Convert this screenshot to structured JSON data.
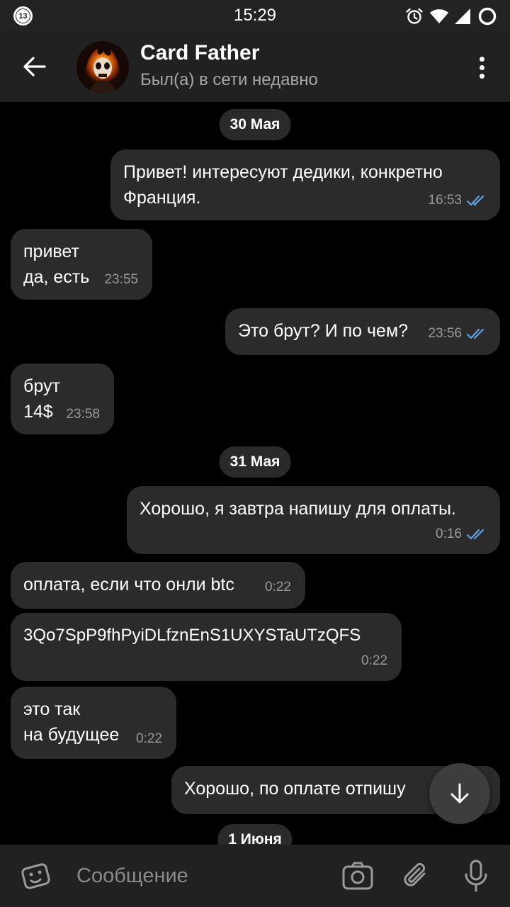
{
  "status_bar": {
    "notification_count": "13",
    "time": "15:29",
    "icons": [
      "alarm-icon",
      "wifi-icon",
      "signal-icon",
      "battery-icon"
    ]
  },
  "header": {
    "name": "Card Father",
    "status": "Был(а) в сети недавно",
    "icons": [
      "back-arrow-icon",
      "avatar",
      "more-vertical-icon"
    ]
  },
  "chat": {
    "dates": [
      "30 Мая",
      "31 Мая",
      "1 Июня"
    ],
    "messages": [
      {
        "direction": "out",
        "text": "Привет! интересуют дедики, конкретно\nФранция.",
        "time": "16:53",
        "read": true
      },
      {
        "direction": "in",
        "text": "привет\nда, есть",
        "time": "23:55"
      },
      {
        "direction": "out",
        "text": "Это брут? И по чем?",
        "time": "23:56",
        "read": true
      },
      {
        "direction": "in",
        "text": "брут\n14$",
        "time": "23:58"
      },
      {
        "direction": "out",
        "text": "Хорошо, я завтра напишу для оплаты.",
        "time": "0:16",
        "read": true
      },
      {
        "direction": "in",
        "text": "оплата, если что онли btc",
        "time": "0:22"
      },
      {
        "direction": "in",
        "text": "3Qo7SpP9fhPyiDLfznEnS1UXYSTaUTzQFS",
        "time": "0:22"
      },
      {
        "direction": "in",
        "text": "это так\nна будущее",
        "time": "0:22"
      },
      {
        "direction": "out",
        "text": "Хорошо, по оплате отпишу"
      }
    ]
  },
  "input": {
    "placeholder": "Сообщение",
    "icons": [
      "emoji-icon",
      "camera-icon",
      "attach-icon",
      "mic-icon"
    ]
  },
  "colors": {
    "background": "#000000",
    "bar": "#212121",
    "bubble": "#2b2b2b",
    "read_check": "#5da3e5"
  }
}
